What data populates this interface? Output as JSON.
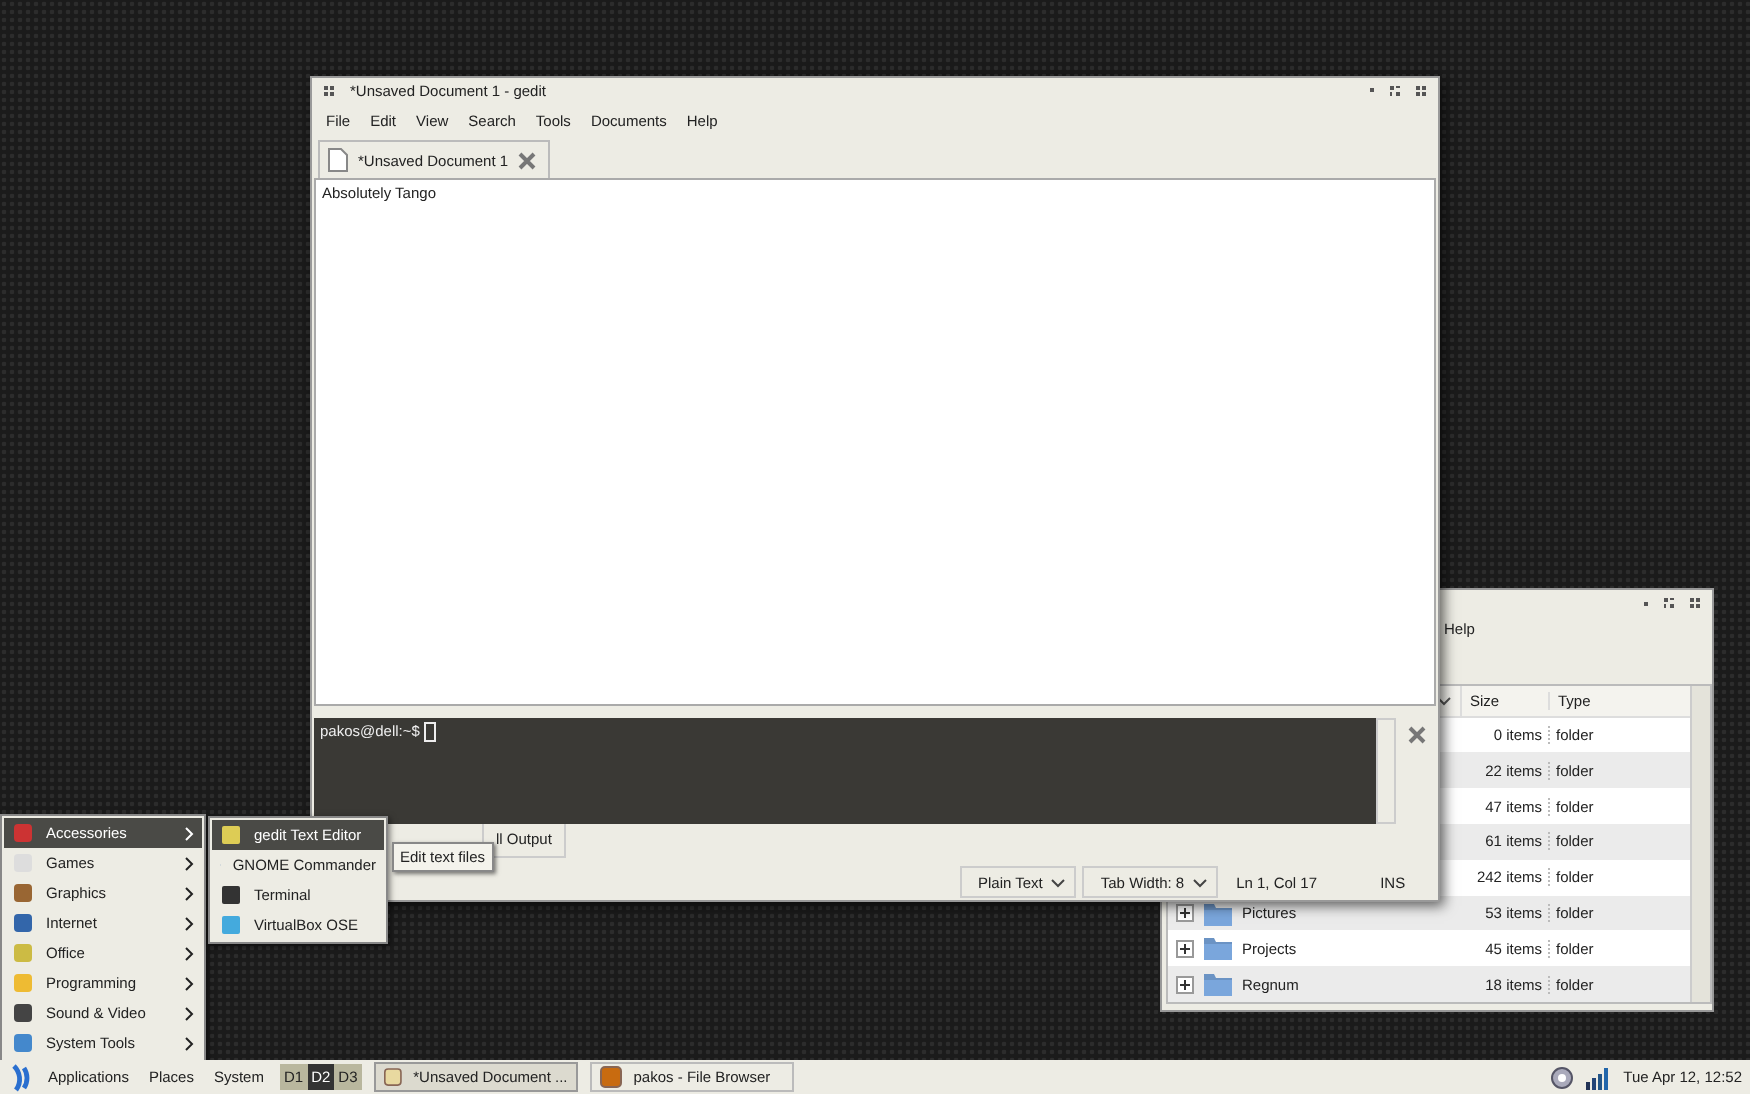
{
  "file_browser": {
    "menu": [
      "Help"
    ],
    "columns": [
      "Size",
      "Type"
    ],
    "rows": [
      {
        "size": "0 items",
        "type": "folder"
      },
      {
        "size": "22 items",
        "type": "folder"
      },
      {
        "size": "47 items",
        "type": "folder"
      },
      {
        "size": "61 items",
        "type": "folder"
      },
      {
        "size": "242 items",
        "type": "folder"
      },
      {
        "name": "Pictures",
        "size": "53 items",
        "type": "folder"
      },
      {
        "name": "Projects",
        "size": "45 items",
        "type": "folder"
      },
      {
        "name": "Regnum",
        "size": "18 items",
        "type": "folder"
      }
    ]
  },
  "gedit": {
    "window": {
      "title": "*Unsaved Document 1 - gedit"
    },
    "menu": [
      "File",
      "Edit",
      "View",
      "Search",
      "Tools",
      "Documents",
      "Help"
    ],
    "tabs": [
      {
        "label": "*Unsaved Document 1",
        "selected": true
      }
    ],
    "text": "Absolutely Tango",
    "terminal": {
      "prompt": "pakos@dell:~$"
    },
    "bottom_tabs": [
      {
        "label": "ll Output",
        "selected": true
      }
    ],
    "status_bar": {
      "language": "Plain Text",
      "tab_width": "Tab Width:  8",
      "position": "Ln 1, Col 17",
      "mode": "INS"
    }
  },
  "applications_menu": {
    "items": [
      {
        "label": "Accessories",
        "selected": true
      },
      {
        "label": "Games",
        "selected": false
      },
      {
        "label": "Graphics",
        "selected": false
      },
      {
        "label": "Internet",
        "selected": false
      },
      {
        "label": "Office",
        "selected": false
      },
      {
        "label": "Programming",
        "selected": false
      },
      {
        "label": "Sound & Video",
        "selected": false
      },
      {
        "label": "System Tools",
        "selected": false
      }
    ],
    "submenu": [
      {
        "label": "gedit Text Editor",
        "selected": true
      },
      {
        "label": "GNOME Commander",
        "selected": false
      },
      {
        "label": "Terminal",
        "selected": false
      },
      {
        "label": "VirtualBox OSE",
        "selected": false
      }
    ],
    "tooltip": "Edit text files"
  },
  "taskbar": {
    "menus": [
      "Applications",
      "Places",
      "System"
    ],
    "workspaces": [
      {
        "label": "D1",
        "selected": false
      },
      {
        "label": "D2",
        "selected": true
      },
      {
        "label": "D3",
        "selected": false
      }
    ],
    "tasks": [
      {
        "label": "*Unsaved Document ...",
        "selected": true
      },
      {
        "label": "pakos - File Browser",
        "selected": false
      }
    ],
    "clock": "Tue Apr 12, 12:52"
  }
}
